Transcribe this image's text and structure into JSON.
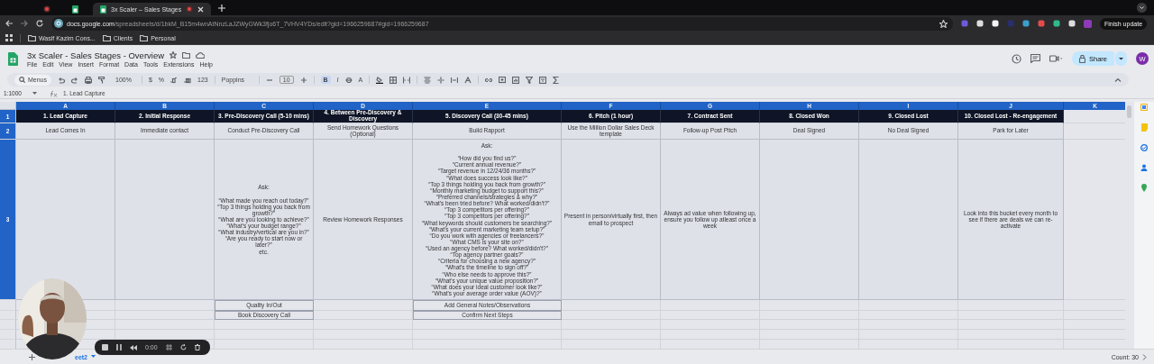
{
  "browser": {
    "tabs": [
      {
        "selected": false
      },
      {
        "selected": false
      },
      {
        "title": "3x Scaler – Sales Stages",
        "selected": true
      }
    ],
    "url_host": "docs.google.com",
    "url_path": "/spreadsheets/d/1bkM_B15m4wnAtNnzLaJZWyGWk3fjo6T_7VHV4YDs/edit?gid=1966259687#gid=1966259687",
    "bookmarks": [
      "Wasif Kazim Cons...",
      "Clients",
      "Personal"
    ],
    "update_button": "Finish update"
  },
  "doc": {
    "title": "3x Scaler - Sales Stages - Overview",
    "menus": [
      "File",
      "Edit",
      "View",
      "Insert",
      "Format",
      "Data",
      "Tools",
      "Extensions",
      "Help"
    ],
    "share": "Share",
    "avatar": "W"
  },
  "toolbar": {
    "search": "Menus",
    "zoom": "100%",
    "currency": "$",
    "percent": "%",
    "number_format": "123",
    "font": "Poppins",
    "font_size": "10",
    "bold": {
      "label": "B",
      "on": true
    },
    "italic": "I",
    "text_color": "A"
  },
  "formula_bar": {
    "name_box": "1:1000",
    "formula": "1. Lead Capture"
  },
  "columns": [
    "A",
    "B",
    "C",
    "D",
    "E",
    "F",
    "G",
    "H",
    "I",
    "J",
    "K"
  ],
  "rows": [
    {
      "number": "1",
      "kind": "title",
      "cells": [
        "1. Lead Capture",
        "2. Initial Response",
        "3. Pre-Discovery Call (5-10 mins)",
        "4. Between Pre-Discovery & Discovery",
        "5. Discovery Call (30-45 mins)",
        "6. Pitch (1 hour)",
        "7. Contract Sent",
        "8. Closed Won",
        "9. Closed Lost",
        "10. Closed Lost - Re-engagement",
        null
      ]
    },
    {
      "number": "2",
      "kind": "data",
      "cells": [
        "Lead Comes In",
        "Immediate contact",
        "Conduct Pre-Discovery Call",
        "Send Homework Questions (Optional)",
        "Build Rapport",
        "Use the Million Dollar Sales Deck template",
        "Follow-up Post Pitch",
        "Deal Signed",
        "No Deal Signed",
        "Park for Later",
        null
      ]
    },
    {
      "number": "3",
      "kind": "tall",
      "cells": [
        null,
        null,
        "Ask:\n\n“What made you reach out today?”\n“Top 3 things holding you back from growth?”\n“What are you looking to achieve?”\n“What's your budget range?”\n“What industry/vertical are you in?”\n“Are you ready to start now or later?”\netc.",
        "Review Homework Responses",
        "Ask:\n\n“How did you find us?”\n“Current annual revenue?”\n“Target revenue in 12/24/36 months?”\n“What does success look like?”\n“Top 3 things holding you back from growth?”\n“Monthly marketing budget to support this?”\n“Preferred channels/strategies & why?”\n“What's been tried before? What worked/didn't?”\n“Top 3 competitors per offering?”\n“Top 3 competitors per offering?”\n“What keywords should customers be searching?”\n“What's your current marketing team setup?”\n“Do you work with agencies or freelancers?”\n“What CMS is your site on?”\n“Used an agency before? What worked/didn't?”\n“Top agency partner goals?”\n“Criteria for choosing a new agency?”\n“What's the timeline to sign off?”\n“Who else needs to approve this?”\n“What's your unique value proposition?”\n“What does your ideal customer look like?”\n“What's your average order value (AOV)?”",
        "Present in person/virtually first, then email to prospect",
        "Always ad value when following up, ensure you follow up atleast once a week",
        null,
        null,
        "Look into this bucket every month to see if there are deals we can re-activate",
        null
      ]
    },
    {
      "kind": "small",
      "cells": [
        null,
        null,
        "Quality In/Out",
        null,
        "Add General Notes/Observations",
        null,
        null,
        null,
        null,
        null,
        null
      ]
    },
    {
      "kind": "small",
      "cells": [
        null,
        null,
        "Book Discovery Call",
        null,
        "Confirm Next Steps",
        null,
        null,
        null,
        null,
        null,
        null
      ]
    }
  ],
  "sheet_tab": "eet2",
  "status": "Count: 30",
  "recorder": {
    "time": "0:00"
  }
}
